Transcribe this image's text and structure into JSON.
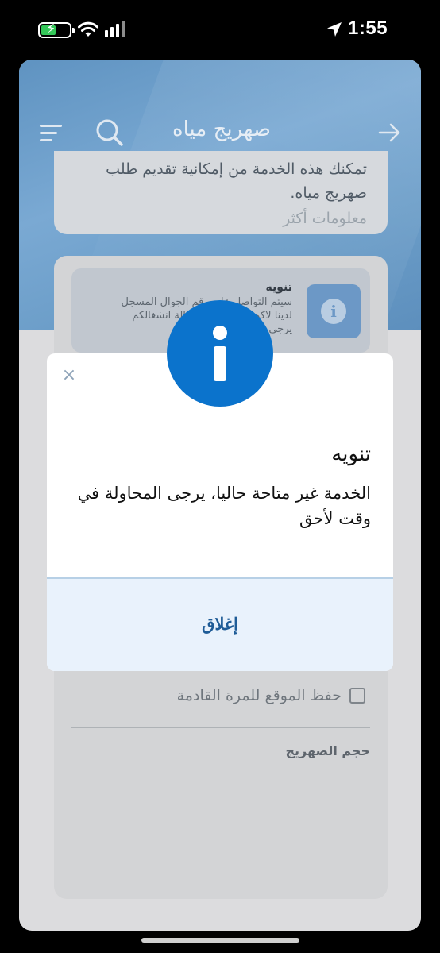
{
  "status_bar": {
    "time": "1:55",
    "battery_color": "#34c759"
  },
  "header": {
    "title": "صهريج مياه",
    "icons": [
      "menu-icon",
      "search-icon",
      "back-arrow-icon"
    ]
  },
  "service_info": {
    "description": "تمكنك هذه الخدمة من إمكانية تقديم طلب صهريج مياه.",
    "more_link": "معلومات أكثر"
  },
  "notice": {
    "title": "تنويه",
    "body_line1": "سيتم التواصل على رقم الجوال المسجل",
    "body_line2": "لدينا لاكمال الطلب في حالة انشغالكم",
    "body_line3": "يرجى الطلب في وقت آخر"
  },
  "form": {
    "save_location_label": "حفظ الموقع للمرة القادمة",
    "save_location_checked": false,
    "tank_size_label": "حجم الصهريج"
  },
  "dialog": {
    "close_glyph": "×",
    "title": "تنويه",
    "message": "الخدمة غير متاحة حاليا، يرجى المحاولة في وقت لأحق",
    "button_label": "إغلاق",
    "badge_color": "#0b73cc",
    "button_color": "#1f5c97"
  }
}
